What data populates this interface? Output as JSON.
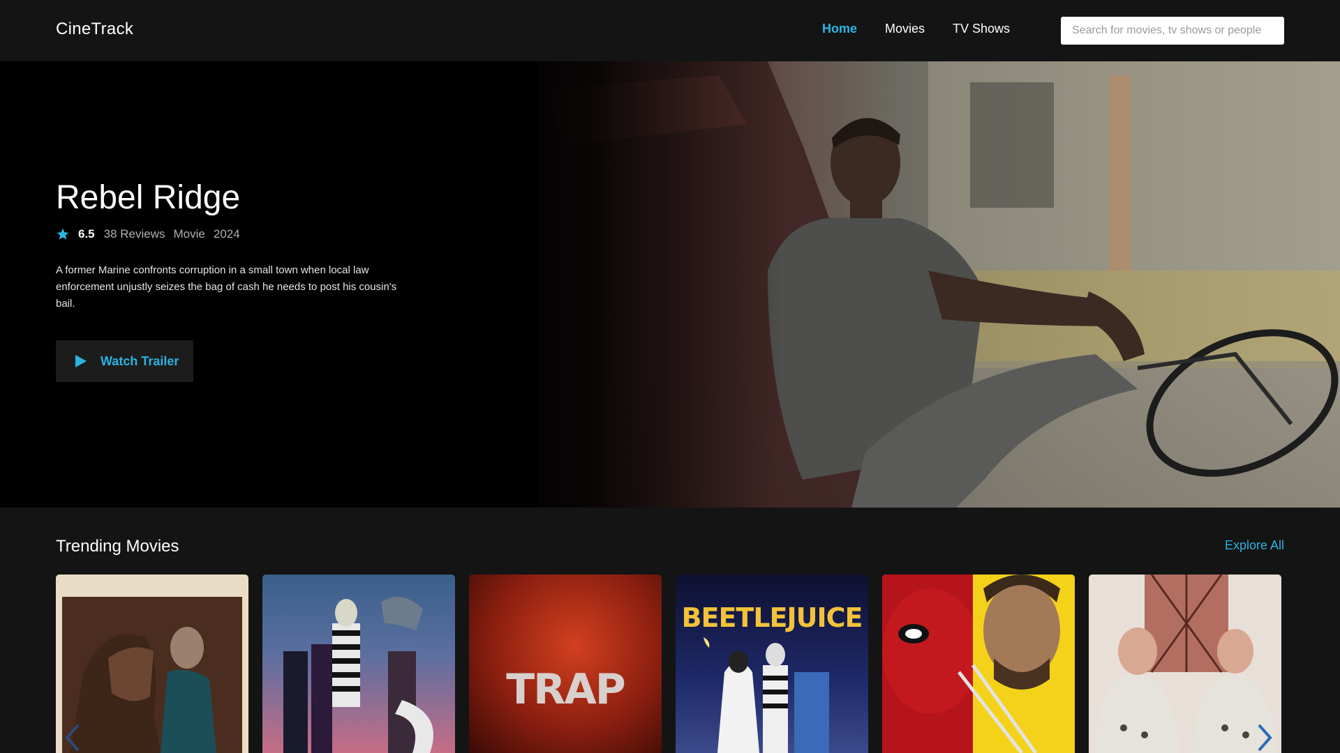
{
  "nav": {
    "logo": "CineTrack",
    "links": [
      {
        "label": "Home",
        "active": true
      },
      {
        "label": "Movies",
        "active": false
      },
      {
        "label": "TV Shows",
        "active": false
      }
    ],
    "search_placeholder": "Search for movies, tv shows or people"
  },
  "hero": {
    "title": "Rebel Ridge",
    "rating": "6.5",
    "reviews": "38 Reviews",
    "type": "Movie",
    "year": "2024",
    "description": "A former Marine confronts corruption in a small town when local law enforcement unjustly seizes the bag of cash he needs to post his cousin's bail.",
    "button_label": "Watch Trailer"
  },
  "trending": {
    "title": "Trending Movies",
    "explore_label": "Explore All",
    "posters": [
      {
        "name": "rebel-ridge-poster",
        "text": ""
      },
      {
        "name": "beetlejuice-beetlejuice-poster",
        "text": ""
      },
      {
        "name": "trap-poster",
        "text": "TRAP"
      },
      {
        "name": "beetlejuice-poster",
        "text": "BEETLEJUICE"
      },
      {
        "name": "deadpool-wolverine-poster",
        "text": ""
      },
      {
        "name": "astronauts-poster",
        "text": ""
      }
    ]
  },
  "colors": {
    "accent": "#2bb3e0",
    "background": "#141414",
    "hero_background": "#000000",
    "button_background": "#1c1c1c"
  }
}
